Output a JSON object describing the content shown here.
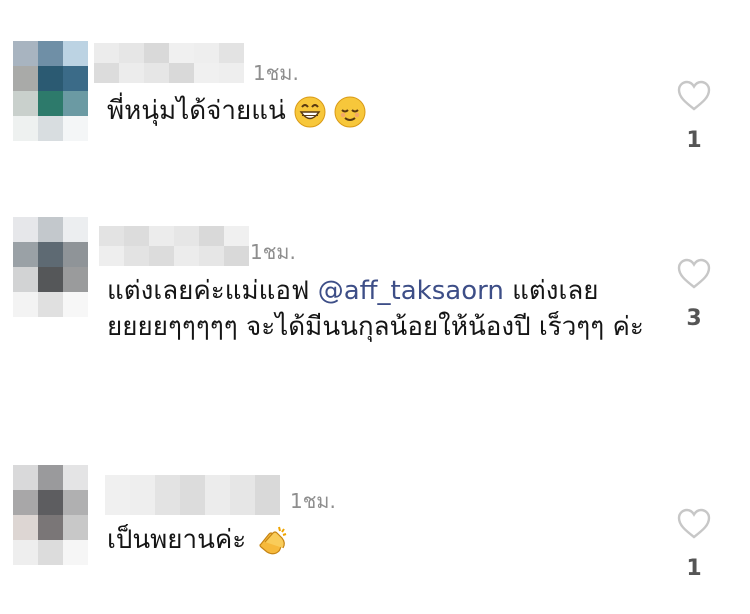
{
  "comments": [
    {
      "time": "1ชม.",
      "text": "พี่หนุ่มได้จ่ายแน่",
      "emojis": [
        "grinning-face",
        "relieved-face"
      ],
      "likes": "1",
      "avatar_colors": [
        "#a8b4c0",
        "#6f8fa6",
        "#bcd3e3",
        "#a9aaa8",
        "#2b5a72",
        "#3b6b88",
        "#c9d0cc",
        "#2d7a6b",
        "#6b9aa3",
        "#eef1f0",
        "#d8dde0",
        "#f4f6f7"
      ]
    },
    {
      "time": "1ชม.",
      "text_before": "แต่งเลยค่ะแม่แอฟ ",
      "mention": "@aff_taksaorn",
      "text_after": " แต่งเลย ยยยยๆๆๆๆๆ จะได้มีนนกุลน้อยให้น้องปี เร็วๆๆ ค่ะ",
      "likes": "3",
      "avatar_colors": [
        "#e6e7ea",
        "#c3c8cc",
        "#eceef0",
        "#9aa1a6",
        "#5e6a73",
        "#8f9498",
        "#d2d3d4",
        "#555759",
        "#9a9b9c",
        "#f3f3f3",
        "#e0e0e0",
        "#f7f7f7"
      ]
    },
    {
      "time": "1ชม.",
      "text": "เป็นพยานค่ะ",
      "emojis": [
        "clapping-hands"
      ],
      "likes": "1",
      "avatar_colors": [
        "#d9d9da",
        "#9a9a9c",
        "#e4e4e5",
        "#a8a7a8",
        "#5d5d60",
        "#b0b0b1",
        "#ddd6d3",
        "#7a7677",
        "#c8c8c8",
        "#eeeeee",
        "#dcdcdc",
        "#f6f6f6"
      ]
    }
  ]
}
